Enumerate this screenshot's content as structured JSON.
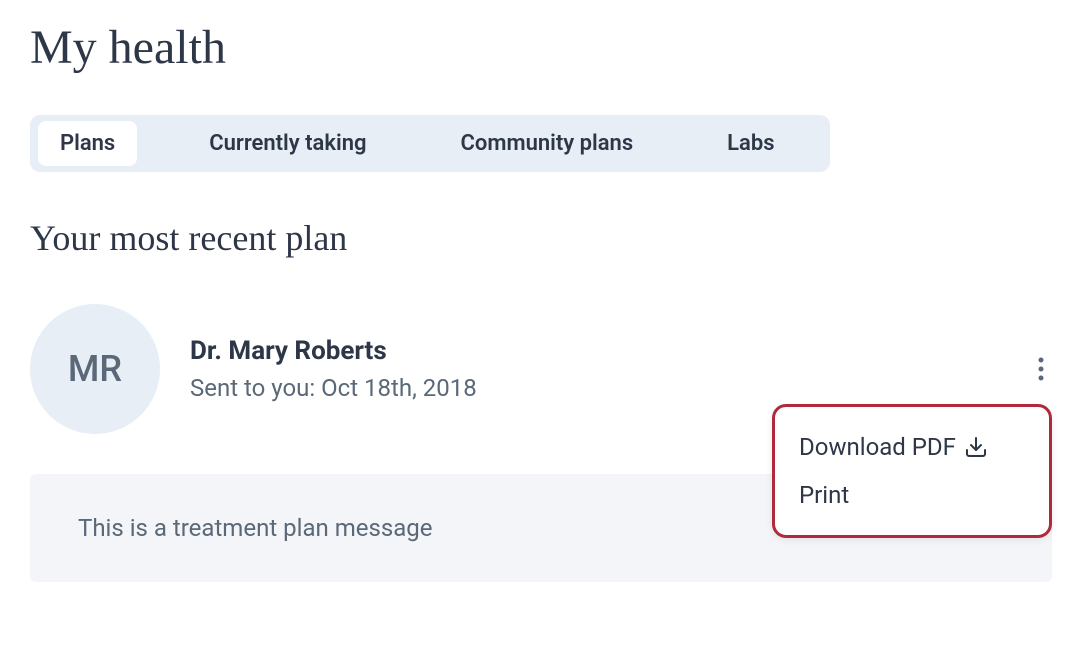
{
  "page": {
    "title": "My health"
  },
  "tabs": [
    {
      "label": "Plans",
      "active": true
    },
    {
      "label": "Currently taking",
      "active": false
    },
    {
      "label": "Community plans",
      "active": false
    },
    {
      "label": "Labs",
      "active": false
    }
  ],
  "section": {
    "title": "Your most recent plan"
  },
  "plan": {
    "avatar_initials": "MR",
    "doctor_name": "Dr. Mary Roberts",
    "sent_label": "Sent to you: Oct 18th, 2018",
    "message": "This is a treatment plan message"
  },
  "menu": {
    "download_label": "Download PDF",
    "print_label": "Print"
  }
}
